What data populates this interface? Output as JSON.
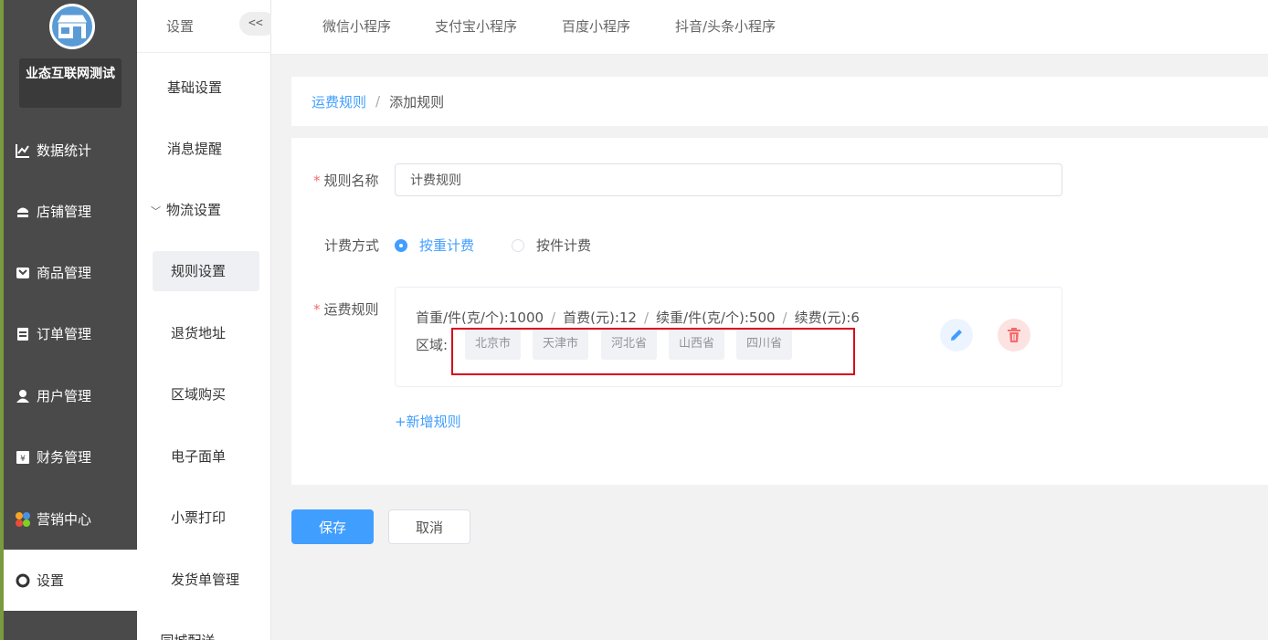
{
  "sidebar": {
    "shop_name": "业态互联网测试",
    "items": [
      {
        "label": "数据统计",
        "icon": "line-chart-icon"
      },
      {
        "label": "店铺管理",
        "icon": "shop-icon"
      },
      {
        "label": "商品管理",
        "icon": "goods-icon"
      },
      {
        "label": "订单管理",
        "icon": "order-icon"
      },
      {
        "label": "用户管理",
        "icon": "user-icon"
      },
      {
        "label": "财务管理",
        "icon": "finance-icon"
      },
      {
        "label": "营销中心",
        "icon": "marketing-icon"
      },
      {
        "label": "设置",
        "icon": "gear-icon",
        "active": true
      }
    ],
    "colors": {
      "bg": "#4a4a4a",
      "active_bg": "#ffffff"
    }
  },
  "submenu": {
    "title": "设置",
    "collapse_label": "<<",
    "items": [
      {
        "label": "基础设置"
      },
      {
        "label": "消息提醒"
      },
      {
        "label": "物流设置",
        "group": true
      },
      {
        "label": "规则设置",
        "active": true
      },
      {
        "label": "退货地址"
      },
      {
        "label": "区域购买"
      },
      {
        "label": "电子面单"
      },
      {
        "label": "小票打印"
      },
      {
        "label": "发货单管理"
      },
      {
        "label": "同城配送",
        "group": true
      }
    ]
  },
  "topbar": {
    "tabs": [
      "微信小程序",
      "支付宝小程序",
      "百度小程序",
      "抖音/头条小程序"
    ]
  },
  "breadcrumb": {
    "parent": "运费规则",
    "separator": "/",
    "current": "添加规则"
  },
  "form": {
    "name_label": "规则名称",
    "name_value": "计费规则",
    "method_label": "计费方式",
    "method_options": [
      {
        "label": "按重计费",
        "checked": true
      },
      {
        "label": "按件计费",
        "checked": false
      }
    ],
    "rule_label": "运费规则",
    "rule": {
      "parts": [
        "首重/件(克/个):1000",
        "首费(元):12",
        "续重/件(克/个):500",
        "续费(元):6"
      ],
      "separator": "/",
      "region_label": "区域:",
      "regions": [
        "北京市",
        "天津市",
        "河北省",
        "山西省",
        "四川省"
      ]
    },
    "add_rule_label": "+新增规则",
    "required_mark": "*"
  },
  "actions": {
    "save_label": "保存",
    "cancel_label": "取消"
  },
  "colors": {
    "primary": "#409eff",
    "danger": "#f56c6c",
    "highlight_border": "#d9001b"
  }
}
